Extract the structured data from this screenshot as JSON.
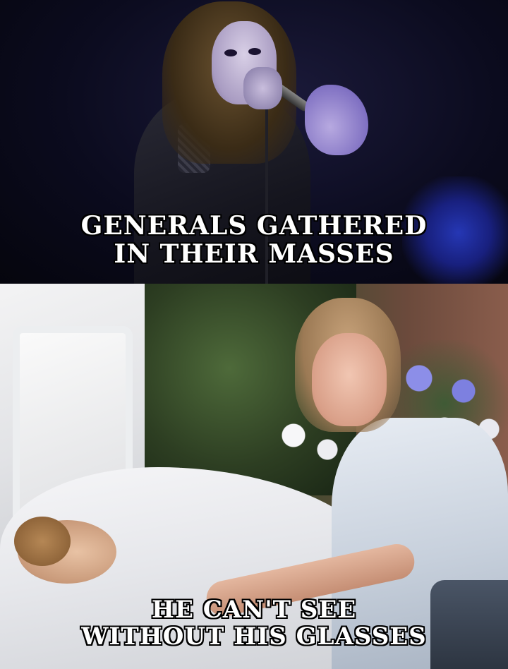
{
  "meme": {
    "top_panel": {
      "caption_line1": "GENERALS GATHERED",
      "caption_line2": "IN THEIR MASSES"
    },
    "bottom_panel": {
      "caption_line1": "HE CAN'T SEE",
      "caption_line2": "WITHOUT HIS GLASSES"
    }
  }
}
